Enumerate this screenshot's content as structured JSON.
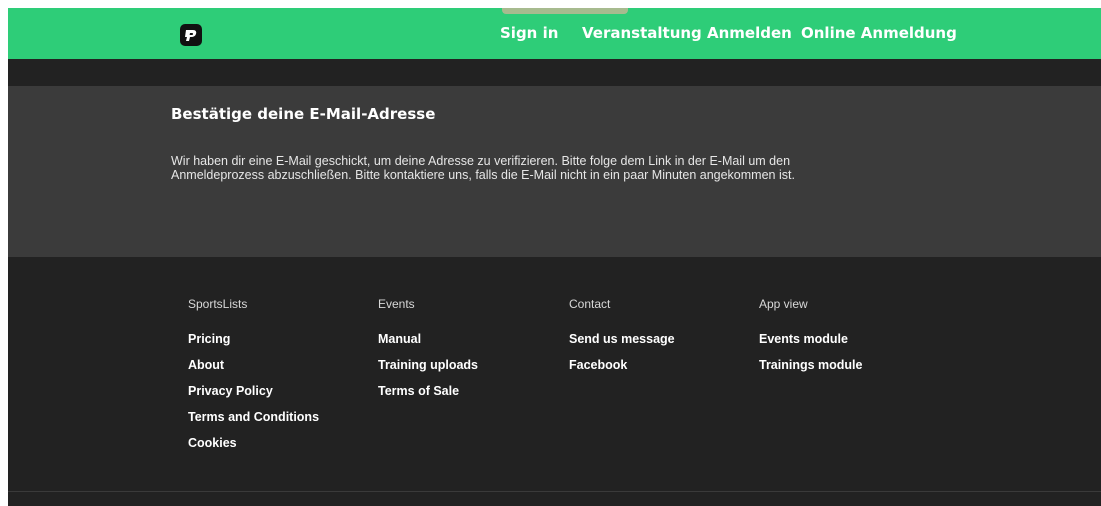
{
  "header": {
    "logo_icon": "p-logo-icon",
    "nav": [
      {
        "label": "Sign in"
      },
      {
        "label": "Veranstaltung Anmelden"
      },
      {
        "label": "Online Anmeldung"
      }
    ]
  },
  "main": {
    "title": "Bestätige deine E-Mail-Adresse",
    "message_line1": "Wir haben dir eine E-Mail geschickt, um deine Adresse zu verifizieren. Bitte folge dem Link in der E-Mail um den",
    "message_line2": "Anmeldeprozess abzuschließen. Bitte kontaktiere uns, falls die E-Mail nicht in ein paar Minuten angekommen ist."
  },
  "footer": {
    "columns": [
      {
        "heading": "SportsLists",
        "links": [
          "Pricing",
          "About",
          "Privacy Policy",
          "Terms and Conditions",
          "Cookies"
        ]
      },
      {
        "heading": "Events",
        "links": [
          "Manual",
          "Training uploads",
          "Terms of Sale"
        ]
      },
      {
        "heading": "Contact",
        "links": [
          "Send us message",
          "Facebook"
        ]
      },
      {
        "heading": "App view",
        "links": [
          "Events module",
          "Trainings module"
        ]
      }
    ]
  },
  "colors": {
    "brand_green": "#2ecd78",
    "dark_bg": "#222222",
    "panel_bg": "#3b3b3b"
  }
}
